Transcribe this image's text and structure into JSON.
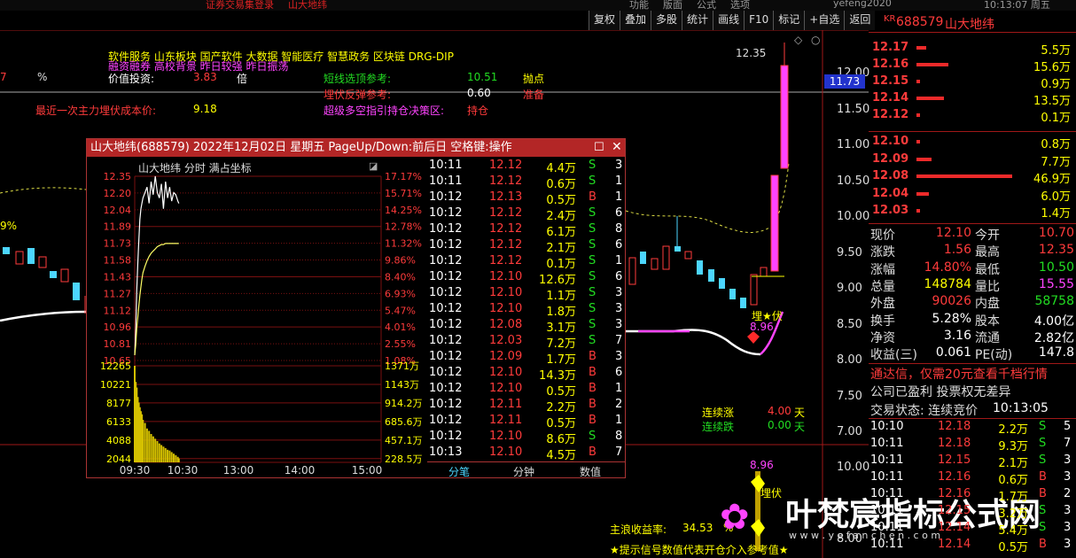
{
  "top_strip": [
    "证券交易集登录",
    "山大地纬",
    "功能",
    "版面",
    "公式",
    "选项",
    "yefeng2020",
    "10:13:07 周五"
  ],
  "toolbar": [
    "复权",
    "叠加",
    "多股",
    "统计",
    "画线",
    "F10",
    "标记",
    "+自选",
    "返回"
  ],
  "stock": {
    "market_badge": "KR",
    "code": "688579",
    "name": "山大地纬"
  },
  "order_book": {
    "asks": [
      {
        "price": "12.17",
        "vol": "5.5万",
        "bar": 0.1
      },
      {
        "price": "12.16",
        "vol": "15.6万",
        "bar": 0.33
      },
      {
        "price": "12.15",
        "vol": "0.9万",
        "bar": 0.02
      },
      {
        "price": "12.14",
        "vol": "13.5万",
        "bar": 0.29
      },
      {
        "price": "12.12",
        "vol": "0.1万",
        "bar": 0.01
      }
    ],
    "bids": [
      {
        "price": "12.10",
        "vol": "0.8万",
        "bar": 0.02
      },
      {
        "price": "12.09",
        "vol": "7.7万",
        "bar": 0.16
      },
      {
        "price": "12.08",
        "vol": "46.9万",
        "bar": 1.0
      },
      {
        "price": "12.04",
        "vol": "6.0万",
        "bar": 0.13
      },
      {
        "price": "12.03",
        "vol": "1.4万",
        "bar": 0.03
      }
    ]
  },
  "stats": [
    {
      "l1": "现价",
      "v1": "12.10",
      "l2": "今开",
      "v2": "10.70"
    },
    {
      "l1": "涨跌",
      "v1": "1.56",
      "l2": "最高",
      "v2": "12.35"
    },
    {
      "l1": "涨幅",
      "v1": "14.80%",
      "l2": "最低",
      "v2": "10.50"
    },
    {
      "l1": "总量",
      "v1": "148784",
      "l2": "量比",
      "v2": "15.55"
    },
    {
      "l1": "外盘",
      "v1": "90026",
      "l2": "内盘",
      "v2": "58758"
    },
    {
      "l1": "换手",
      "v1": "5.28%",
      "l2": "股本",
      "v2": "4.00亿"
    },
    {
      "l1": "净资",
      "v1": "3.16",
      "l2": "流通",
      "v2": "2.82亿"
    },
    {
      "l1": "收益(三)",
      "v1": "0.061",
      "l2": "PE(动)",
      "v2": "147.8"
    }
  ],
  "notices": [
    "通达信，仅需20元查看千档行情",
    "公司已盈利 投票权无差异"
  ],
  "trade_status": {
    "label": "交易状态: 连续竞价",
    "time": "10:13:05"
  },
  "right_ticks": [
    {
      "t": "10:10",
      "p": "12.18",
      "v": "2.2万",
      "s": "S",
      "n": "5"
    },
    {
      "t": "10:11",
      "p": "12.18",
      "v": "9.3万",
      "s": "S",
      "n": "7"
    },
    {
      "t": "10:11",
      "p": "12.15",
      "v": "2.1万",
      "s": "S",
      "n": "3"
    },
    {
      "t": "10:11",
      "p": "12.16",
      "v": "0.6万",
      "s": "B",
      "n": "3"
    },
    {
      "t": "10:11",
      "p": "12.16",
      "v": "1.7万",
      "s": "B",
      "n": "2"
    },
    {
      "t": "10:11",
      "p": "12.15",
      "v": "3.2万",
      "s": "S",
      "n": "3"
    },
    {
      "t": "10:11",
      "p": "12.14",
      "v": "5.4万",
      "s": "S",
      "n": "3"
    },
    {
      "t": "10:11",
      "p": "12.14",
      "v": "0.5万",
      "s": "B",
      "n": "3"
    }
  ],
  "main_text": {
    "tags_line": "软件服务      山东板块      国产软件 大数据 智能医疗 智慧政务 区块链 DRG-DIP",
    "tags_line2": "融资融券 高校背景 昨日较强 昨日振荡",
    "value_label": "价值投资:",
    "value_num": "3.83",
    "value_unit": "倍",
    "short_label": "短线选顶参考:",
    "short_num": "10.51",
    "short_tag": "抛点",
    "ambush_label": "埋伏反弹参考:",
    "ambush_num": "0.60",
    "ambush_tag": "准备",
    "cost_label": "最近一次主力埋伏成本价:",
    "cost_num": "9.18",
    "super_label": "超级多空指引持仓决策区:",
    "super_tag": "持仓",
    "left_num": "7",
    "left_pct": "%",
    "pct_label": "9%",
    "peak_label": "12.35",
    "low_marker": "8.96",
    "low_marker2": "8.96",
    "ambush_mark": "埋★伏",
    "ambush_mark2": "埋伏",
    "cont_up": "连续涨",
    "cont_up_num": "4.00",
    "cont_up_unit": "天",
    "cont_dn": "连续跌",
    "cont_dn_num": "0.00",
    "cont_dn_unit": "天",
    "profit_label": "主浪收益率:",
    "profit_num": "34.53",
    "profit_unit": "%",
    "hint": "★提示信号数值代表开仓介入参考值★",
    "watermark": "叶梵宸指标公式网",
    "watermark_url": "w w w . y e f a n c h e n . c o m",
    "cur_price_tag": "11.73"
  },
  "axis": {
    "upper_ticks": [
      "12.00",
      "11.50",
      "11.00",
      "10.50",
      "10.00",
      "9.50",
      "9.00",
      "8.50",
      "8.00",
      "7.50",
      "7.00"
    ],
    "lower_ticks": [
      "10.00",
      "8.00"
    ]
  },
  "popup": {
    "title": "山大地纬(688579)  2022年12月02日  星期五  PageUp/Down:前后日  空格键:操作",
    "chart_title": "山大地纬  分时 满占坐标",
    "price_labels": [
      "12.35",
      "12.20",
      "12.04",
      "11.89",
      "11.73",
      "11.58",
      "11.43",
      "11.27",
      "11.12",
      "10.96",
      "10.81",
      "10.65"
    ],
    "pct_labels": [
      "17.17%",
      "15.71%",
      "14.25%",
      "12.78%",
      "11.32%",
      "9.86%",
      "8.40%",
      "6.93%",
      "5.47%",
      "4.01%",
      "2.55%",
      "1.08%"
    ],
    "vol_labels": [
      "12265",
      "10221",
      "8177",
      "6133",
      "4088",
      "2044"
    ],
    "vol_right_labels": [
      "1371万",
      "1143万",
      "914.2万",
      "685.6万",
      "457.1万",
      "228.5万"
    ],
    "time_labels": [
      "09:30",
      "10:30",
      "13:00",
      "14:00",
      "15:00"
    ],
    "tabs": [
      "分笔",
      "分钟",
      "数值"
    ],
    "ticks": [
      {
        "t": "10:11",
        "p": "12.12",
        "v": "4.4万",
        "s": "S",
        "n": "3"
      },
      {
        "t": "10:11",
        "p": "12.12",
        "v": "0.6万",
        "s": "S",
        "n": "1"
      },
      {
        "t": "10:12",
        "p": "12.13",
        "v": "0.5万",
        "s": "B",
        "n": "1"
      },
      {
        "t": "10:12",
        "p": "12.12",
        "v": "2.4万",
        "s": "S",
        "n": "6"
      },
      {
        "t": "10:12",
        "p": "12.12",
        "v": "6.1万",
        "s": "S",
        "n": "8"
      },
      {
        "t": "10:12",
        "p": "12.12",
        "v": "2.1万",
        "s": "S",
        "n": "6"
      },
      {
        "t": "10:12",
        "p": "12.12",
        "v": "0.1万",
        "s": "S",
        "n": "1"
      },
      {
        "t": "10:12",
        "p": "12.10",
        "v": "12.6万",
        "s": "S",
        "n": "6"
      },
      {
        "t": "10:12",
        "p": "12.10",
        "v": "1.1万",
        "s": "S",
        "n": "3"
      },
      {
        "t": "10:12",
        "p": "12.10",
        "v": "1.8万",
        "s": "S",
        "n": "3"
      },
      {
        "t": "10:12",
        "p": "12.08",
        "v": "3.1万",
        "s": "S",
        "n": "3"
      },
      {
        "t": "10:12",
        "p": "12.03",
        "v": "7.2万",
        "s": "S",
        "n": "7"
      },
      {
        "t": "10:12",
        "p": "12.09",
        "v": "1.7万",
        "s": "B",
        "n": "3"
      },
      {
        "t": "10:12",
        "p": "12.10",
        "v": "14.3万",
        "s": "B",
        "n": "6"
      },
      {
        "t": "10:12",
        "p": "12.10",
        "v": "0.5万",
        "s": "B",
        "n": "1"
      },
      {
        "t": "10:12",
        "p": "12.11",
        "v": "2.2万",
        "s": "B",
        "n": "2"
      },
      {
        "t": "10:12",
        "p": "12.11",
        "v": "0.5万",
        "s": "B",
        "n": "1"
      },
      {
        "t": "10:12",
        "p": "12.10",
        "v": "8.6万",
        "s": "S",
        "n": "8"
      },
      {
        "t": "10:13",
        "p": "12.10",
        "v": "4.5万",
        "s": "B",
        "n": "7"
      }
    ]
  },
  "chart_data": {
    "type": "line",
    "title": "山大地纬  分时 满占坐标",
    "xlabel": "",
    "ylabel": "",
    "prev_close": 10.54,
    "ylim": [
      10.65,
      12.35
    ],
    "time": [
      "09:30",
      "09:31",
      "09:32",
      "09:33",
      "09:34",
      "09:35",
      "09:36",
      "09:37",
      "09:38",
      "09:40",
      "09:42",
      "09:44",
      "09:46",
      "09:48",
      "09:50",
      "09:52",
      "09:54",
      "09:56",
      "09:58",
      "10:00",
      "10:02",
      "10:04",
      "10:06",
      "10:08",
      "10:10",
      "10:12",
      "10:13"
    ],
    "series": [
      {
        "values": [
          10.7,
          10.95,
          11.3,
          11.55,
          11.75,
          11.95,
          12.05,
          12.1,
          12.15,
          12.2,
          12.25,
          12.1,
          12.3,
          12.18,
          12.35,
          12.2,
          12.15,
          12.28,
          12.05,
          12.3,
          12.15,
          12.25,
          12.12,
          12.2,
          12.18,
          12.12,
          12.1
        ]
      },
      {
        "values": [
          10.7,
          10.8,
          10.95,
          11.05,
          11.15,
          11.25,
          11.33,
          11.4,
          11.46,
          11.52,
          11.57,
          11.61,
          11.64,
          11.66,
          11.68,
          11.7,
          11.71,
          11.72,
          11.72,
          11.73,
          11.73,
          11.73,
          11.73,
          11.73,
          11.73,
          11.73,
          11.73
        ]
      }
    ],
    "volume": [
      12265,
      10221,
      9500,
      8300,
      7600,
      7000,
      6500,
      6100,
      5400,
      5000,
      4300,
      4000,
      3600,
      3300,
      3000,
      2700,
      2400,
      2200,
      2000,
      1800,
      1600,
      1500,
      1300,
      1100,
      900,
      700,
      500
    ]
  }
}
